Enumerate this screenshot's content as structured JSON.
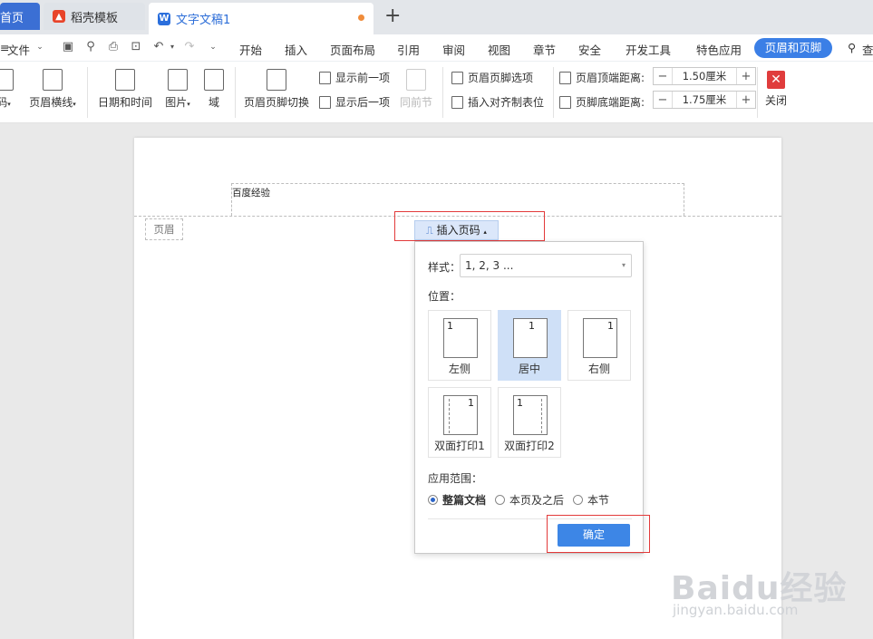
{
  "tabs": [
    {
      "label": "首页"
    },
    {
      "label": "稻壳模板",
      "icon": "flame-icon"
    },
    {
      "label": "文字文稿1",
      "icon": "wps-writer-icon"
    }
  ],
  "menubar": {
    "file": "文件",
    "items": [
      "开始",
      "插入",
      "页面布局",
      "引用",
      "审阅",
      "视图",
      "章节",
      "安全",
      "开发工具",
      "特色应用"
    ],
    "active": "页眉和页脚",
    "search": "查"
  },
  "ribbon": {
    "page_number": "码",
    "header_line": "页眉横线",
    "date_time": "日期和时间",
    "picture": "图片",
    "field": "域",
    "switch": "页眉页脚切换",
    "show_prev": "显示前一项",
    "show_next": "显示后一项",
    "same_as_prev": "同前节",
    "hf_options": "页眉页脚选项",
    "insert_align_tab": "插入对齐制表位",
    "header_top_label": "页眉顶端距离:",
    "header_top_value": "1.50厘米",
    "footer_bottom_label": "页脚底端距离:",
    "footer_bottom_value": "1.75厘米",
    "close": "关闭"
  },
  "page": {
    "header_text": "百度经验",
    "header_label": "页眉"
  },
  "insert_page_number": {
    "button_label": "插入页码",
    "style_label": "样式：",
    "style_value": "1, 2, 3 ...",
    "position_label": "位置：",
    "positions": [
      {
        "label": "左侧",
        "selected": false
      },
      {
        "label": "居中",
        "selected": true
      },
      {
        "label": "右侧",
        "selected": false
      },
      {
        "label": "双面打印1",
        "selected": false
      },
      {
        "label": "双面打印2",
        "selected": false
      }
    ],
    "sample_number": "1",
    "scope_label": "应用范围：",
    "scope_options": [
      {
        "label": "整篇文档",
        "checked": true
      },
      {
        "label": "本页及之后",
        "checked": false
      },
      {
        "label": "本节",
        "checked": false
      }
    ],
    "ok": "确定"
  },
  "watermark": {
    "brand": "Baidu经验",
    "url": "jingyan.baidu.com"
  }
}
